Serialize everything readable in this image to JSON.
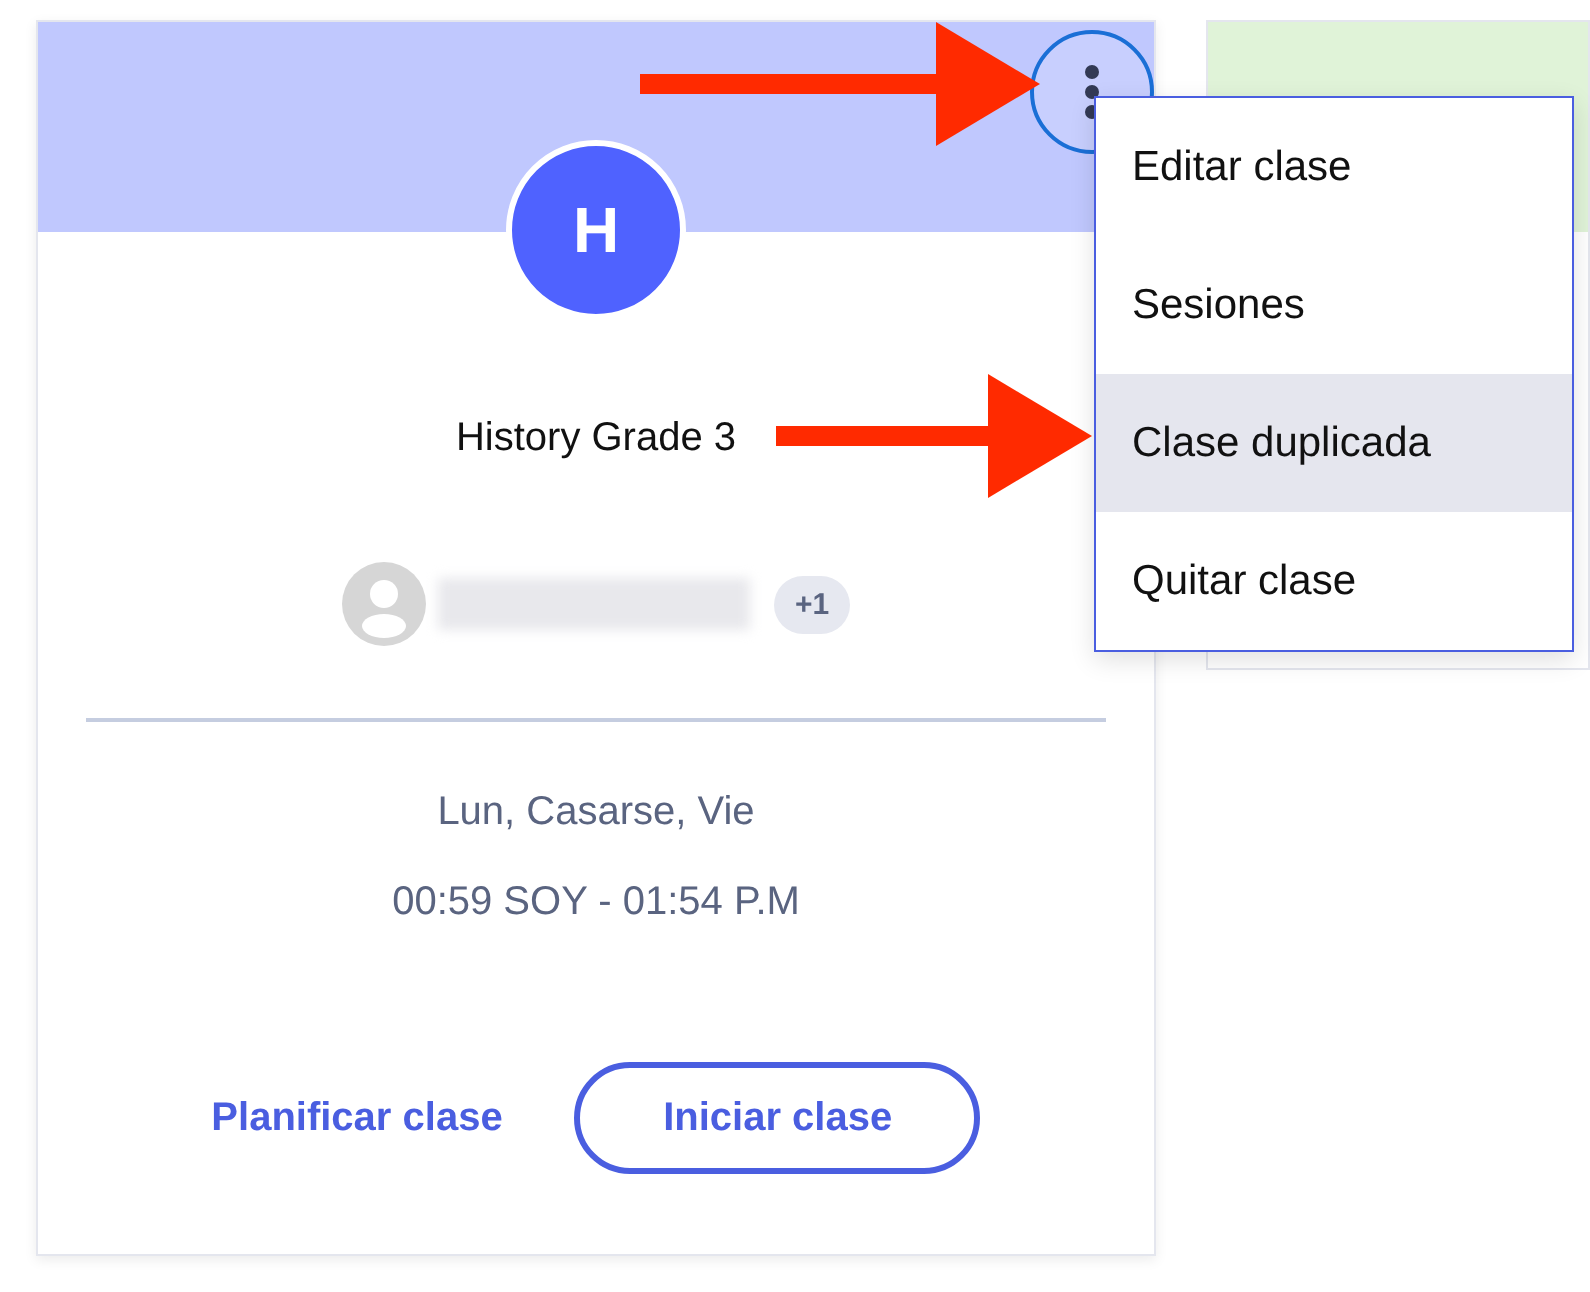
{
  "class_card": {
    "avatar_letter": "H",
    "title": "History Grade 3",
    "extra_teachers": "+1",
    "days": "Lun, Casarse, Vie",
    "time": "00:59 SOY - 01:54 P.M",
    "actions": [
      {
        "kind": "link",
        "label": "Planificar clase"
      },
      {
        "kind": "outline",
        "label": "Iniciar clase"
      }
    ]
  },
  "menu": {
    "open": true,
    "items": [
      {
        "label": "Editar clase",
        "selected": false
      },
      {
        "label": "Sesiones",
        "selected": false
      },
      {
        "label": "Clase duplicada",
        "selected": true
      },
      {
        "label": "Quitar clase",
        "selected": false
      }
    ]
  }
}
